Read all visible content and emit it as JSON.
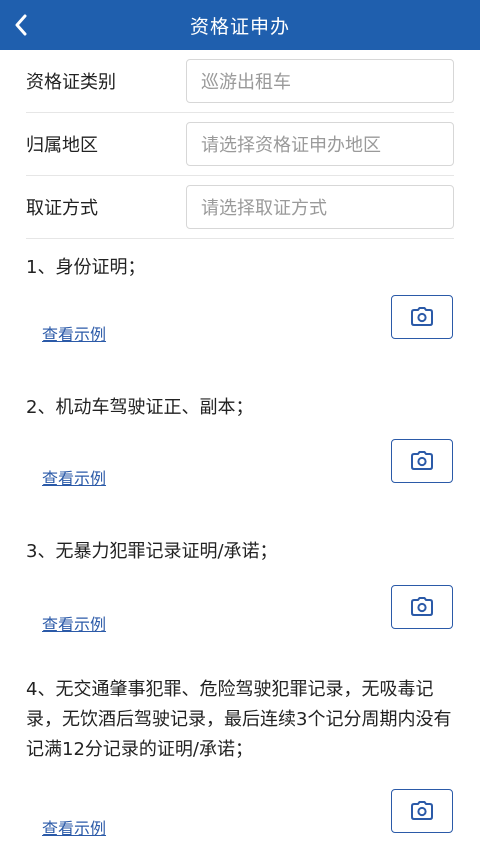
{
  "header": {
    "title": "资格证申办",
    "back_icon": "chevron-left-icon",
    "color": "#1f5fae"
  },
  "form": {
    "rows": [
      {
        "label": "资格证类别",
        "value": "巡游出租车"
      },
      {
        "label": "归属地区",
        "placeholder": "请选择资格证申办地区"
      },
      {
        "label": "取证方式",
        "placeholder": "请选择取证方式"
      }
    ]
  },
  "documents": [
    {
      "title": "1、身份证明；",
      "link": "查看示例",
      "icon": "camera-icon"
    },
    {
      "title": "2、机动车驾驶证正、副本；",
      "link": "查看示例",
      "icon": "camera-icon"
    },
    {
      "title": "3、无暴力犯罪记录证明/承诺；",
      "link": "查看示例",
      "icon": "camera-icon"
    },
    {
      "title": "4、无交通肇事犯罪、危险驾驶犯罪记录，无吸毒记录，无饮酒后驾驶记录，最后连续3个记分周期内没有记满12分记录的证明/承诺；",
      "link": "查看示例",
      "icon": "camera-icon"
    }
  ]
}
